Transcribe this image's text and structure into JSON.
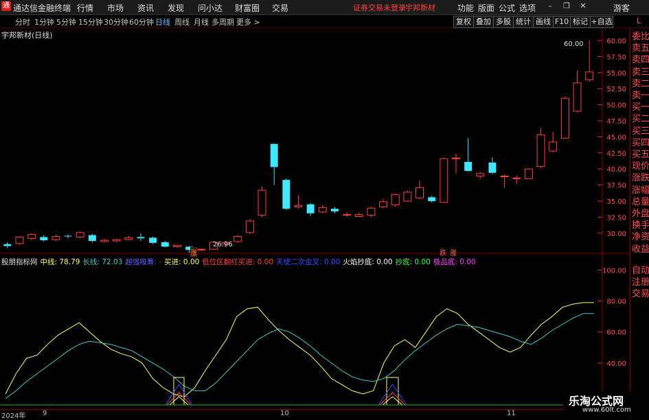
{
  "app": {
    "title": "通达信金融终端",
    "logo": "通"
  },
  "menu": [
    "行情",
    "市场",
    "资讯",
    "发现",
    "问小达",
    "财富圈",
    "交易"
  ],
  "menu_right": {
    "warning": "证券交易未登录",
    "stock": "宇邦新材",
    "items": [
      "功能",
      "版面",
      "公式",
      "选项"
    ],
    "user": "游客"
  },
  "periods": [
    "分时",
    "1分钟",
    "5分钟",
    "15分钟",
    "30分钟",
    "60分钟",
    "日线",
    "周线",
    "月线",
    "多周期",
    "更多 >"
  ],
  "active_period": "日线",
  "toolbar_right": [
    "复权",
    "叠加",
    "多股",
    "统计",
    "画线",
    "F10",
    "标记",
    "+自选"
  ],
  "toolbar_flag": "L",
  "stock_name": "宇邦新材(日线)",
  "right_panel": [
    "委比",
    "卖五",
    "卖四",
    "卖三",
    "卖二",
    "卖一",
    "买一",
    "买二",
    "买三",
    "买四",
    "买五",
    "现价",
    "涨跌",
    "涨幅",
    "总量",
    "外盘",
    "换手",
    "净资",
    "收益"
  ],
  "right_panel2": [
    "自动",
    "注册",
    "交易"
  ],
  "indicator": {
    "name": "股朋指标网",
    "items": [
      {
        "label": "中线: 78.79",
        "color": "#ffff60"
      },
      {
        "label": "长线: 72.03",
        "color": "#40c8c8"
      },
      {
        "label": "超强吸筹: -",
        "color": "#6060ff"
      },
      {
        "label": "买进: 0.00",
        "color": "#ffff60"
      },
      {
        "label": "低位区翻红买进: 0.00",
        "color": "#ff4040"
      },
      {
        "label": "天使二次金叉: 0.00",
        "color": "#3050ff"
      },
      {
        "label": "火焰抄底: 0.00",
        "color": "#ffffff"
      },
      {
        "label": "抄底: 0.00",
        "color": "#40ff40"
      },
      {
        "label": "极品底: 0.00",
        "color": "#ff40ff"
      }
    ]
  },
  "markers": {
    "low_label": "26.96",
    "high_label": "60.00",
    "tag1": "涨",
    "tag2": "跌",
    "tag3": "涨"
  },
  "dates": [
    "2024年",
    "9",
    "10",
    "11"
  ],
  "watermark": {
    "name": "乐淘公式网",
    "url": "www.60lt.com"
  },
  "chart_data": [
    {
      "type": "candlestick",
      "title": "宇邦新材(日线)",
      "yticks": [
        30.0,
        32.5,
        35.0,
        37.5,
        40.0,
        42.5,
        45.0,
        47.5,
        50.0,
        52.5,
        55.0,
        57.5,
        60.0
      ],
      "ylim": [
        27.2,
        61.5
      ],
      "candles": [
        {
          "o": 28.3,
          "c": 28.0,
          "h": 28.6,
          "l": 27.7
        },
        {
          "o": 28.4,
          "c": 29.4,
          "h": 29.6,
          "l": 28.2
        },
        {
          "o": 29.2,
          "c": 29.8,
          "h": 30.0,
          "l": 28.9
        },
        {
          "o": 29.4,
          "c": 28.9,
          "h": 29.7,
          "l": 28.7
        },
        {
          "o": 29.0,
          "c": 29.5,
          "h": 29.8,
          "l": 28.8
        },
        {
          "o": 29.6,
          "c": 29.5,
          "h": 29.8,
          "l": 29.2
        },
        {
          "o": 29.4,
          "c": 30.1,
          "h": 30.3,
          "l": 29.2
        },
        {
          "o": 29.7,
          "c": 28.8,
          "h": 29.9,
          "l": 28.6
        },
        {
          "o": 28.7,
          "c": 28.9,
          "h": 29.1,
          "l": 28.6
        },
        {
          "o": 28.8,
          "c": 29.0,
          "h": 29.1,
          "l": 28.6
        },
        {
          "o": 29.0,
          "c": 29.3,
          "h": 29.6,
          "l": 28.9
        },
        {
          "o": 29.4,
          "c": 29.2,
          "h": 30.0,
          "l": 28.8
        },
        {
          "o": 29.3,
          "c": 28.5,
          "h": 29.5,
          "l": 28.3
        },
        {
          "o": 28.6,
          "c": 27.9,
          "h": 28.8,
          "l": 27.8
        },
        {
          "o": 27.9,
          "c": 28.1,
          "h": 28.2,
          "l": 27.7
        },
        {
          "o": 27.9,
          "c": 27.4,
          "h": 28.0,
          "l": 26.96
        },
        {
          "o": 27.4,
          "c": 27.5,
          "h": 27.6,
          "l": 27.2
        },
        {
          "o": 27.5,
          "c": 28.6,
          "h": 28.8,
          "l": 27.4
        },
        {
          "o": 28.3,
          "c": 28.6,
          "h": 28.8,
          "l": 28.0
        },
        {
          "o": 28.7,
          "c": 29.5,
          "h": 29.7,
          "l": 28.5
        },
        {
          "o": 30.1,
          "c": 31.9,
          "h": 32.2,
          "l": 29.9
        },
        {
          "o": 32.8,
          "c": 36.7,
          "h": 37.3,
          "l": 32.5
        },
        {
          "o": 43.9,
          "c": 40.3,
          "h": 44.0,
          "l": 37.5
        },
        {
          "o": 38.3,
          "c": 33.8,
          "h": 38.5,
          "l": 33.6
        },
        {
          "o": 34.1,
          "c": 34.3,
          "h": 35.9,
          "l": 33.8
        },
        {
          "o": 34.5,
          "c": 33.1,
          "h": 34.7,
          "l": 32.7
        },
        {
          "o": 33.3,
          "c": 34.0,
          "h": 34.4,
          "l": 33.1
        },
        {
          "o": 33.8,
          "c": 33.4,
          "h": 34.1,
          "l": 33.1
        },
        {
          "o": 32.8,
          "c": 32.9,
          "h": 33.3,
          "l": 32.6
        },
        {
          "o": 32.6,
          "c": 32.9,
          "h": 33.2,
          "l": 32.5
        },
        {
          "o": 32.8,
          "c": 33.9,
          "h": 34.1,
          "l": 32.5
        },
        {
          "o": 34.1,
          "c": 34.9,
          "h": 35.3,
          "l": 33.9
        },
        {
          "o": 34.4,
          "c": 36.0,
          "h": 36.2,
          "l": 34.1
        },
        {
          "o": 35.0,
          "c": 36.4,
          "h": 36.6,
          "l": 34.9
        },
        {
          "o": 35.5,
          "c": 37.1,
          "h": 38.2,
          "l": 35.3
        },
        {
          "o": 35.6,
          "c": 35.0,
          "h": 35.8,
          "l": 34.8
        },
        {
          "o": 34.8,
          "c": 41.6,
          "h": 41.8,
          "l": 34.7
        },
        {
          "o": 41.7,
          "c": 41.7,
          "h": 42.4,
          "l": 39.3
        },
        {
          "o": 41.1,
          "c": 39.7,
          "h": 44.8,
          "l": 39.6
        },
        {
          "o": 38.9,
          "c": 39.3,
          "h": 39.5,
          "l": 38.5
        },
        {
          "o": 41.0,
          "c": 39.4,
          "h": 41.8,
          "l": 39.2
        },
        {
          "o": 38.8,
          "c": 38.9,
          "h": 39.1,
          "l": 37.1
        },
        {
          "o": 38.5,
          "c": 38.6,
          "h": 39.0,
          "l": 37.6
        },
        {
          "o": 38.5,
          "c": 40.0,
          "h": 40.1,
          "l": 38.4
        },
        {
          "o": 40.4,
          "c": 45.3,
          "h": 46.4,
          "l": 40.1
        },
        {
          "o": 42.8,
          "c": 44.2,
          "h": 45.8,
          "l": 42.6
        },
        {
          "o": 44.8,
          "c": 51.0,
          "h": 51.3,
          "l": 44.7
        },
        {
          "o": 49.0,
          "c": 53.4,
          "h": 55.3,
          "l": 48.8
        },
        {
          "o": 53.9,
          "c": 55.1,
          "h": 60.0,
          "l": 53.6
        }
      ]
    },
    {
      "type": "line",
      "title": "股朋指标网",
      "yticks": [
        20.0,
        40.0,
        60.0,
        80.0,
        100.0
      ],
      "ylim": [
        12,
        106
      ],
      "series": [
        {
          "name": "中线",
          "color": "#ffff60",
          "values": [
            20,
            33,
            43,
            45,
            52,
            58,
            62,
            66,
            60,
            54,
            49,
            46,
            44,
            40,
            30,
            24,
            20,
            18,
            24,
            35,
            45,
            55,
            70,
            75,
            76,
            68,
            61,
            55,
            50,
            45,
            38,
            30,
            26,
            22,
            20,
            22,
            40,
            51,
            55,
            50,
            60,
            70,
            75,
            72,
            65,
            60,
            55,
            50,
            47,
            50,
            58,
            65,
            70,
            76,
            78,
            79,
            79
          ]
        },
        {
          "name": "长线",
          "color": "#40c8c8",
          "values": [
            17,
            22,
            28,
            33,
            38,
            43,
            48,
            52,
            54,
            53,
            52,
            50,
            48,
            44,
            40,
            36,
            31,
            25,
            22,
            22,
            27,
            34,
            41,
            48,
            55,
            59,
            62,
            60,
            56,
            51,
            45,
            40,
            35,
            31,
            29,
            28,
            30,
            35,
            42,
            48,
            53,
            58,
            62,
            65,
            64,
            63,
            61,
            59,
            57,
            54,
            52,
            56,
            61,
            65,
            69,
            72,
            72
          ]
        }
      ]
    }
  ]
}
